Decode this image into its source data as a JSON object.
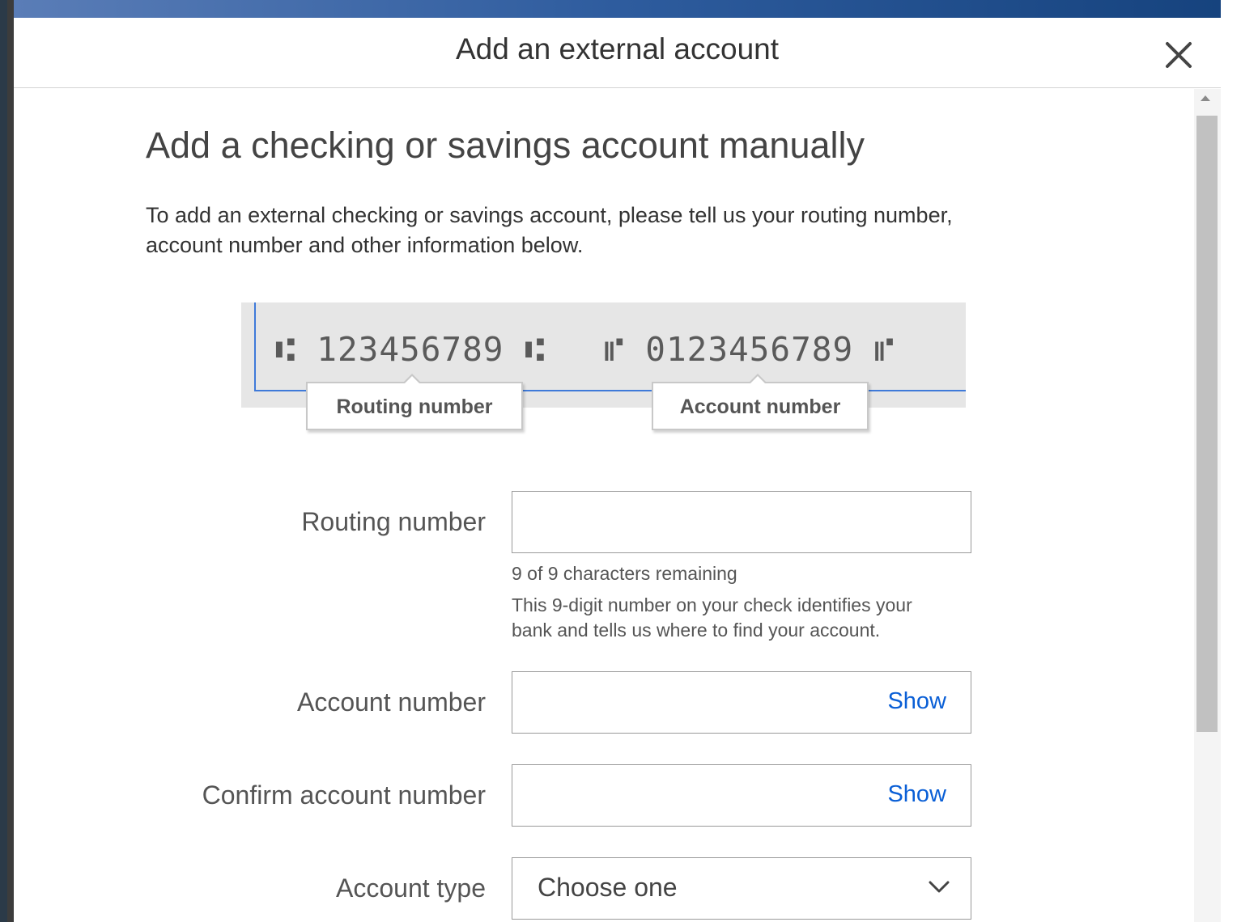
{
  "dialog": {
    "title": "Add an external account",
    "close_icon": "close-icon"
  },
  "section": {
    "title": "Add a checking or savings account manually",
    "intro_line1": "To add an external checking or savings account, please tell us your routing number,",
    "intro_line2": "account number and other information below."
  },
  "illustration": {
    "routing_micr": "⑆ 123456789 ⑆",
    "account_micr": "⑈ 0123456789 ⑈",
    "routing_callout": "Routing number",
    "account_callout": "Account number"
  },
  "form": {
    "routing": {
      "label": "Routing number",
      "value": "",
      "remaining": "9 of 9 characters remaining",
      "help_line1": "This 9-digit number on your check identifies your",
      "help_line2": "bank and tells us where to find your account."
    },
    "account": {
      "label": "Account number",
      "value": "",
      "show_label": "Show"
    },
    "confirm": {
      "label": "Confirm account number",
      "value": "",
      "show_label": "Show"
    },
    "type": {
      "label": "Account type",
      "selected": "Choose one",
      "chevron_icon": "chevron-down-icon"
    }
  },
  "colors": {
    "link": "#0a5fd6",
    "check_line": "#3f7ad9",
    "header_gradient_start": "#5a7db7",
    "header_gradient_end": "#16437e"
  }
}
